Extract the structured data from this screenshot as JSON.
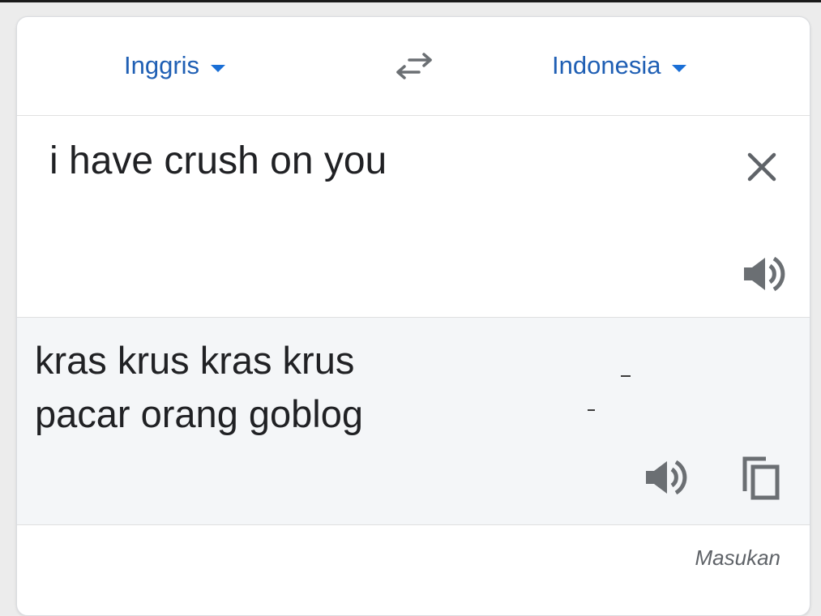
{
  "header": {
    "source_language": "Inggris",
    "target_language": "Indonesia"
  },
  "input": {
    "text": "i have crush on you"
  },
  "output": {
    "line1": "kras krus kras krus",
    "line2": "pacar orang goblog"
  },
  "footer": {
    "feedback_label": "Masukan"
  },
  "colors": {
    "language_link": "#1f5fb4",
    "icon_gray": "#5f6368",
    "output_background": "#f4f6f8"
  },
  "icons": [
    "swap-icon",
    "close-icon",
    "speaker-icon",
    "copy-icon",
    "caret-down-icon"
  ]
}
